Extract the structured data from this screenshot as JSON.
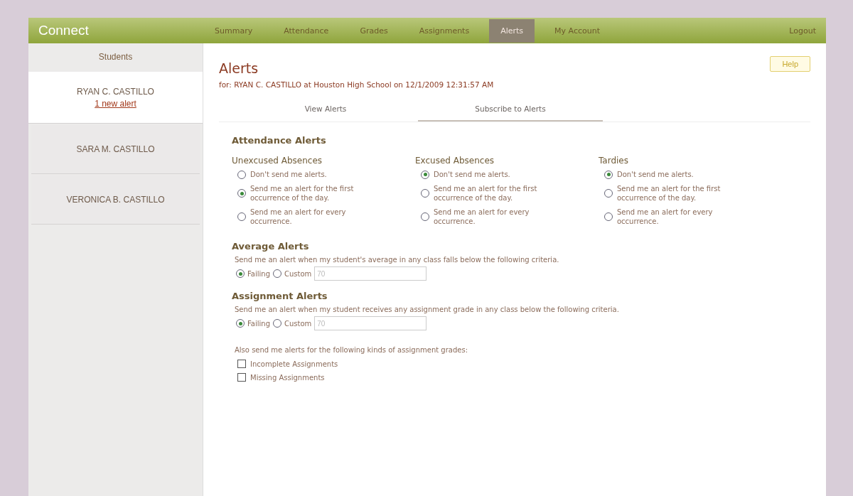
{
  "logo": "Connect",
  "nav": [
    {
      "label": "Summary",
      "selected": false
    },
    {
      "label": "Attendance",
      "selected": false
    },
    {
      "label": "Grades",
      "selected": false
    },
    {
      "label": "Assignments",
      "selected": false
    },
    {
      "label": "Alerts",
      "selected": true
    },
    {
      "label": "My Account",
      "selected": false
    }
  ],
  "logout": "Logout",
  "sidebar": {
    "title": "Students",
    "items": [
      {
        "name": "RYAN C. CASTILLO",
        "link": "1 new alert",
        "selected": true
      },
      {
        "name": "SARA M. CASTILLO",
        "selected": false
      },
      {
        "name": "VERONICA B. CASTILLO",
        "selected": false
      }
    ]
  },
  "page": {
    "title": "Alerts",
    "subtitle": "for: RYAN C. CASTILLO at Houston High School on 12/1/2009 12:31:57 AM",
    "help": "Help"
  },
  "tabs": [
    {
      "label": "View Alerts",
      "selected": false
    },
    {
      "label": "Subscribe to Alerts",
      "selected": true
    }
  ],
  "attendance": {
    "title": "Attendance Alerts",
    "groups": [
      {
        "title": "Unexcused Absences",
        "options": [
          {
            "label": "Don't send me alerts.",
            "selected": false
          },
          {
            "label": "Send me an alert for the first occurrence of the day.",
            "selected": true
          },
          {
            "label": "Send me an alert for every occurrence.",
            "selected": false
          }
        ]
      },
      {
        "title": "Excused Absences",
        "options": [
          {
            "label": "Don't send me alerts.",
            "selected": true
          },
          {
            "label": "Send me an alert for the first occurrence of the day.",
            "selected": false
          },
          {
            "label": "Send me an alert for every occurrence.",
            "selected": false
          }
        ]
      },
      {
        "title": "Tardies",
        "options": [
          {
            "label": "Don't send me alerts.",
            "selected": true
          },
          {
            "label": "Send me an alert for the first occurrence of the day.",
            "selected": false
          },
          {
            "label": "Send me an alert for every occurrence.",
            "selected": false
          }
        ]
      }
    ]
  },
  "criteria": [
    {
      "title": "Average Alerts",
      "text": "Send me an alert when my student's average in any class falls below the following criteria.",
      "options": [
        {
          "label": "Failing",
          "selected": true
        },
        {
          "label": "Custom",
          "selected": false
        }
      ],
      "value": "70"
    },
    {
      "title": "Assignment Alerts",
      "text": "Send me an alert when my student receives any assignment grade in any class below the following criteria.",
      "options": [
        {
          "label": "Failing",
          "selected": true
        },
        {
          "label": "Custom",
          "selected": false
        }
      ],
      "value": "70"
    }
  ],
  "also": {
    "text": "Also send me alerts for the following kinds of assignment grades:",
    "items": [
      {
        "label": "Incomplete Assignments",
        "checked": false
      },
      {
        "label": "Missing Assignments",
        "checked": false
      }
    ]
  }
}
